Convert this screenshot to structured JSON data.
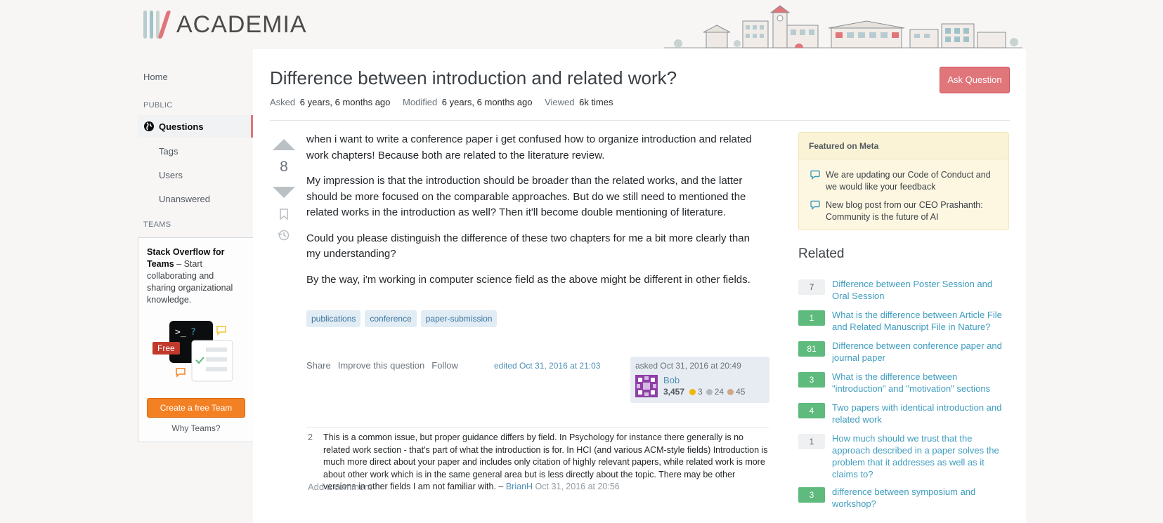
{
  "brand": {
    "name": "ACADEMIA",
    "stripe_colors": [
      "#b7ccd2",
      "#9fc2c9",
      "#c7d4d0",
      "#e0757a"
    ]
  },
  "sidebar": {
    "home": "Home",
    "public_heading": "PUBLIC",
    "questions": "Questions",
    "tags": "Tags",
    "users": "Users",
    "unanswered": "Unanswered",
    "teams_heading": "TEAMS",
    "teams_title": "Stack Overflow for Teams",
    "teams_text": " – Start collaborating and sharing organizational knowledge.",
    "free_badge": "Free",
    "create_team": "Create a free Team",
    "why_teams": "Why Teams?"
  },
  "question": {
    "title": "Difference between introduction and related work?",
    "ask_button": "Ask Question",
    "asked_label": "Asked",
    "asked_value": "6 years, 6 months ago",
    "modified_label": "Modified",
    "modified_value": "6 years, 6 months ago",
    "viewed_label": "Viewed",
    "viewed_value": "6k times",
    "votes": "8",
    "paragraphs": [
      "when i want to write a conference paper i get confused how to organize introduction and related work chapters! Because both are related to the literature review.",
      "My impression is that the introduction should be broader than the related works, and the latter should be more focused on the comparable approaches. But do we still need to mentioned the related works in the introduction as well? Then it'll become double mentioning of literature.",
      "Could you please distinguish the difference of these two chapters for me a bit more clearly than my understanding?",
      "By the way, i'm working in computer science field as the above might be different in other fields."
    ],
    "tags": [
      "publications",
      "conference",
      "paper-submission"
    ],
    "share": "Share",
    "improve": "Improve this question",
    "follow": "Follow",
    "edited": "edited Oct 31, 2016 at 21:03",
    "asked_card": "asked Oct 31, 2016 at 20:49",
    "owner": {
      "name": "Bob",
      "reputation": "3,457",
      "gold": "3",
      "silver": "24",
      "bronze": "45"
    }
  },
  "comment": {
    "score": "2",
    "text": "This is a common issue, but proper guidance differs by field. In Psychology for instance there generally is no related work section - that's part of what the introduction is for. In HCI (and various ACM-style fields) Introduction is much more direct about your paper and includes only citation of highly relevant papers, while related work is more about other work which is in the same general area but is less directly about the topic. There may be other versions in other fields I am not familiar with. – ",
    "user": "BrianH",
    "date": "Oct 31, 2016 at 20:56",
    "add_comment": "Add a comment"
  },
  "featured_meta": {
    "heading": "Featured on Meta",
    "items": [
      "We are updating our Code of Conduct and we would like your feedback",
      "New blog post from our CEO Prashanth: Community is the future of AI"
    ]
  },
  "related": {
    "heading": "Related",
    "items": [
      {
        "score": "7",
        "answered": false,
        "title": "Difference between Poster Session and Oral Session"
      },
      {
        "score": "1",
        "answered": true,
        "title": "What is the difference between Article File and Related Manuscript File in Nature?"
      },
      {
        "score": "81",
        "answered": true,
        "title": "Difference between conference paper and journal paper"
      },
      {
        "score": "3",
        "answered": true,
        "title": "What is the difference between \"introduction\" and \"motivation\" sections"
      },
      {
        "score": "4",
        "answered": true,
        "title": "Two papers with identical introduction and related work"
      },
      {
        "score": "1",
        "answered": false,
        "title": "How much should we trust that the approach described in a paper solves the problem that it addresses as well as it claims to?"
      },
      {
        "score": "3",
        "answered": true,
        "title": "difference between symposium and workshop?"
      }
    ]
  },
  "colors": {
    "accent": "#e0757a",
    "link": "#3e9cbf",
    "answered_green": "#5eba7d",
    "orange_button": "#f48024"
  }
}
